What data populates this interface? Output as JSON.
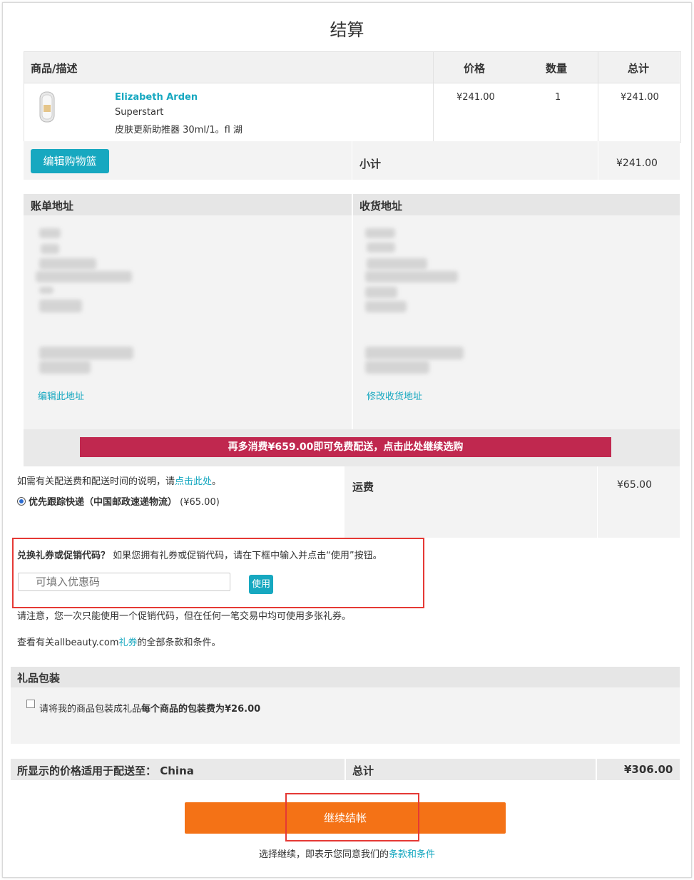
{
  "page": {
    "title": "结算"
  },
  "cart": {
    "headers": {
      "product": "商品/描述",
      "price": "价格",
      "qty": "数量",
      "total": "总计"
    },
    "item": {
      "brand": "Elizabeth Arden",
      "name": "Superstart",
      "desc": "皮肤更新助推器 30ml/1。fl 湖",
      "price": "¥241.00",
      "qty": "1",
      "total": "¥241.00"
    },
    "edit_button": "编辑购物篮",
    "subtotal_label": "小计",
    "subtotal_value": "¥241.00"
  },
  "address": {
    "billing_title": "账单地址",
    "shipping_title": "收货地址",
    "edit_billing": "编辑此地址",
    "edit_shipping": "修改收货地址"
  },
  "promo_banner": "再多消费¥659.00即可免费配送，点击此处继续选购",
  "shipping": {
    "info_prefix": "如需有关配送费和配送时间的说明，请",
    "info_link": "点击此处",
    "info_suffix": "。",
    "option_label": "优先跟踪快递（中国邮政速递物流）",
    "option_price": "(¥65.00)",
    "label": "运费",
    "value": "¥65.00"
  },
  "coupon": {
    "title": "兑换礼券或促销代码？",
    "desc": "如果您拥有礼券或促销代码，请在下框中输入并点击“使用”按钮。",
    "placeholder": "可填入优惠码",
    "apply_button": "使用",
    "note": "请注意，您一次只能使用一个促销代码，但在任何一笔交易中均可使用多张礼券。",
    "terms_prefix": "查看有关allbeauty.com",
    "terms_link": "礼券",
    "terms_suffix": "的全部条款和条件。"
  },
  "gift": {
    "title": "礼品包装",
    "checkbox_text": "请将我的商品包装成礼品",
    "checkbox_bold": "每个商品的包装费为¥26.00"
  },
  "summary": {
    "country_label": "所显示的价格适用于配送至：",
    "country_value": "China",
    "total_label": "总计",
    "total_value": "¥306.00"
  },
  "checkout": {
    "button": "继续结帐",
    "agree_prefix": "选择继续，即表示您同意我们的",
    "agree_link": "条款和条件"
  },
  "colors": {
    "accent": "#17a8c0",
    "banner": "#c0284f",
    "checkout": "#f47216",
    "highlight": "#e53935"
  }
}
